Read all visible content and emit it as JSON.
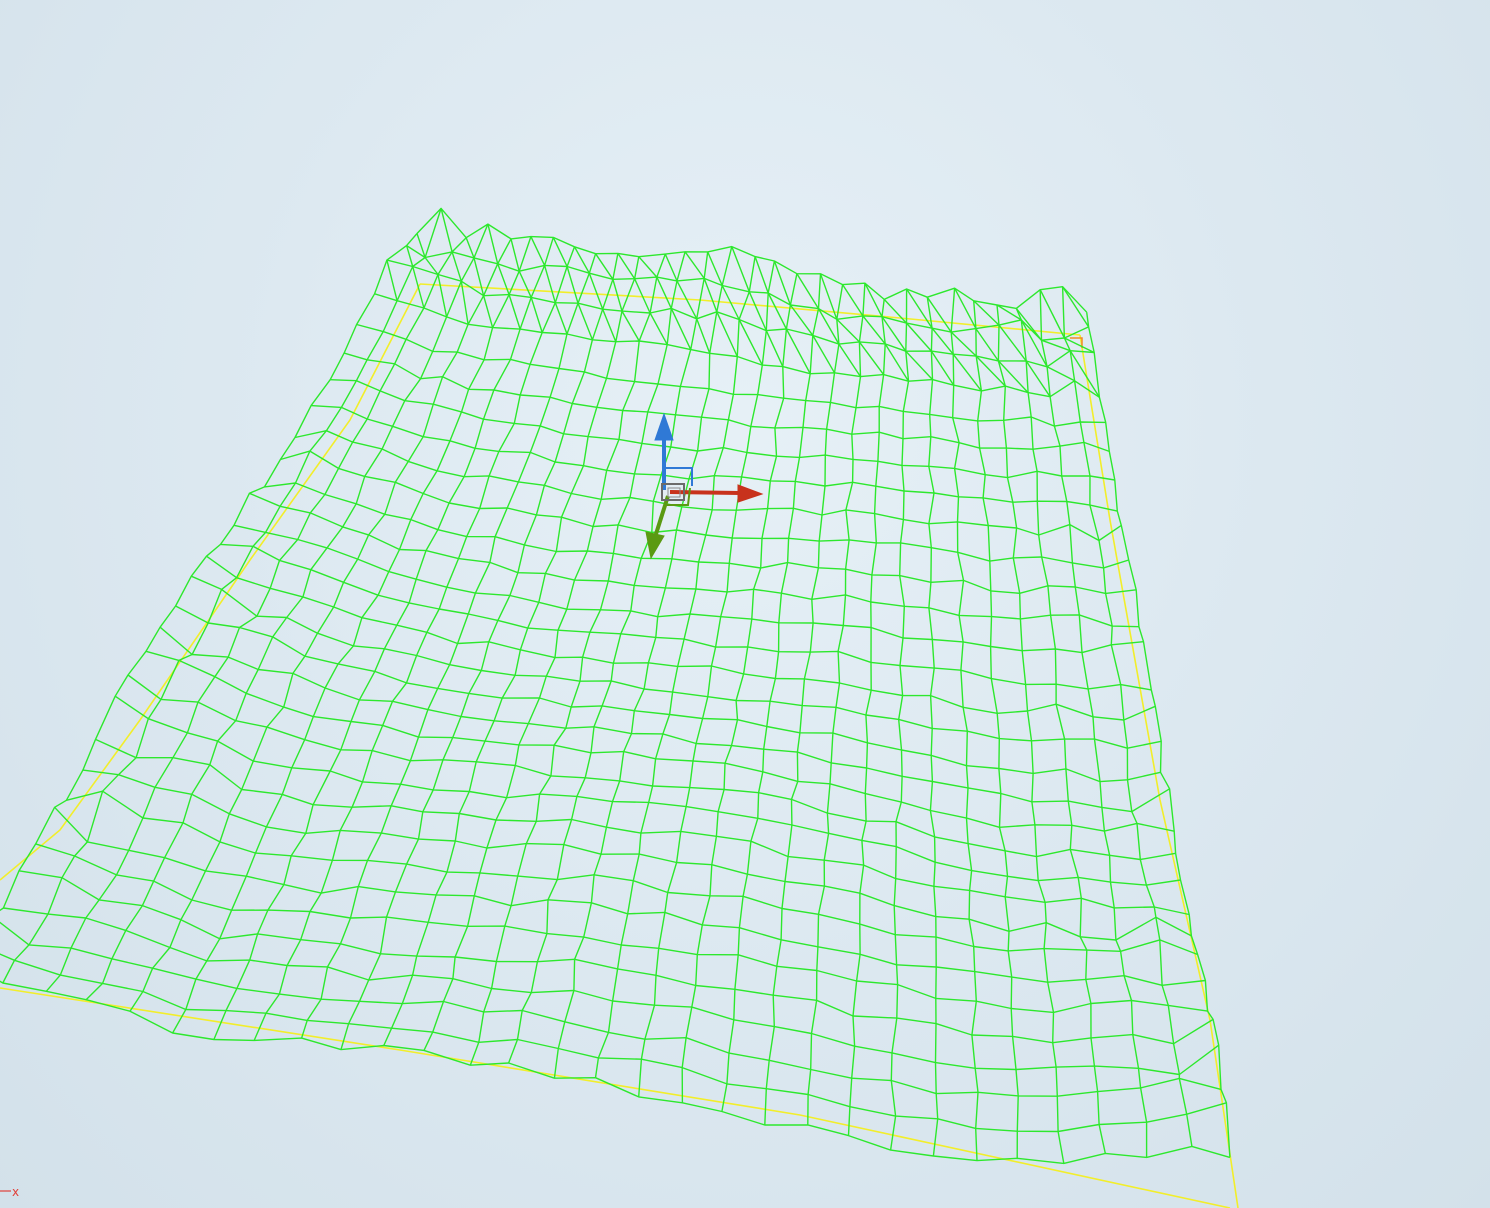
{
  "viewport": {
    "background": "#dde9f1",
    "mesh_color": "#2de82d",
    "boundary_color": "#f2ee2a"
  },
  "terrain_mesh": {
    "render_mode": "wireframe",
    "rows": 30,
    "cols": 30
  },
  "transform_gizmo": {
    "x_axis_color": "#c8321c",
    "y_axis_color": "#5a9a12",
    "z_axis_color": "#2f79d6",
    "center_color": "#6b6b6b"
  },
  "corner_axis_indicator": {
    "label": "x",
    "color": "#e0413a"
  }
}
